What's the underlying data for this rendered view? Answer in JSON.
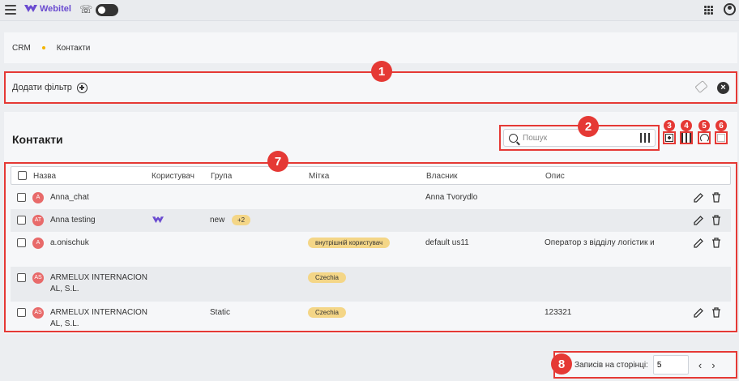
{
  "topbar": {
    "logo_text": "Webitel",
    "icons": {
      "menu": "hamburger-icon",
      "phone": "phone-icon",
      "apps": "apps-grid-icon",
      "account": "account-icon"
    }
  },
  "breadcrumb": {
    "items": [
      "CRM",
      "Контакти"
    ]
  },
  "filter": {
    "add_label": "Додати фільтр"
  },
  "main": {
    "title": "Контакти",
    "search": {
      "placeholder": "Пошук",
      "value": ""
    }
  },
  "table": {
    "columns": [
      "Назва",
      "Користувач",
      "Група",
      "Мітка",
      "Власник",
      "Опис"
    ],
    "rows": [
      {
        "avatar": "A",
        "name": "Anna_chat",
        "user": "",
        "group": "",
        "group_extra": "",
        "tag": "",
        "owner": "Anna Tvorydlo",
        "desc": ""
      },
      {
        "avatar": "AT",
        "name": "Anna testing",
        "user": "webitel-logo",
        "group": "new",
        "group_extra": "+2",
        "tag": "",
        "owner": "",
        "desc": ""
      },
      {
        "avatar": "A",
        "name": "a.onischuk",
        "user": "",
        "group": "",
        "group_extra": "",
        "tag": "внутрішній користувач",
        "owner": "default us11",
        "desc": "Оператор з відділу логістик и"
      },
      {
        "avatar": "AS",
        "name": "ARMELUX INTERNACION AL, S.L.",
        "user": "",
        "group": "",
        "group_extra": "",
        "tag": "Czechia",
        "owner": "",
        "desc": ""
      },
      {
        "avatar": "AS",
        "name": "ARMELUX INTERNACION AL, S.L.",
        "user": "",
        "group": "Static",
        "group_extra": "",
        "tag": "Czechia",
        "owner": "",
        "desc": "123321"
      }
    ]
  },
  "pagination": {
    "label": "Записів на сторінці:",
    "value": "5"
  },
  "annotations": [
    "1",
    "2",
    "3",
    "4",
    "5",
    "6",
    "7",
    "8"
  ],
  "colors": {
    "accent": "#e53935",
    "brand": "#6a4bd0",
    "chip": "#f4d687",
    "avatar": "#e86a6a"
  }
}
